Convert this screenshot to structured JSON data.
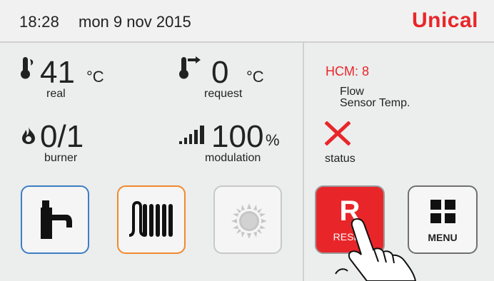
{
  "header": {
    "time": "18:28",
    "date": "mon 9 nov 2015",
    "brand": "Unical"
  },
  "readings": {
    "real_temp": {
      "value": "41",
      "unit": "°C",
      "label": "real"
    },
    "request_temp": {
      "value": "0",
      "unit": "°C",
      "label": "request"
    },
    "burner": {
      "value": "0/1",
      "label": "burner"
    },
    "modulation": {
      "value": "100",
      "unit": "%",
      "label": "modulation"
    }
  },
  "modes": [
    {
      "name": "dhw",
      "icon": "tap-icon",
      "active": true,
      "color": "#3d7ec5"
    },
    {
      "name": "heating",
      "icon": "radiator-icon",
      "active": true,
      "color": "#f08a2e"
    },
    {
      "name": "summer",
      "icon": "sun-icon",
      "active": false,
      "color": "#c8c8c8"
    }
  ],
  "status_panel": {
    "hcm": "HCM:  8",
    "flow_line1": "Flow",
    "flow_line2": "Sensor  Temp.",
    "status_label": "status",
    "status_icon": "x-icon",
    "status_color": "#e8262a"
  },
  "buttons": {
    "reset_letter": "R",
    "reset_label": "RESET",
    "menu_label": "MENU"
  },
  "colors": {
    "accent": "#e8262a",
    "dhw": "#3d7ec5",
    "heating": "#f08a2e",
    "disabled": "#c8c8c8"
  }
}
